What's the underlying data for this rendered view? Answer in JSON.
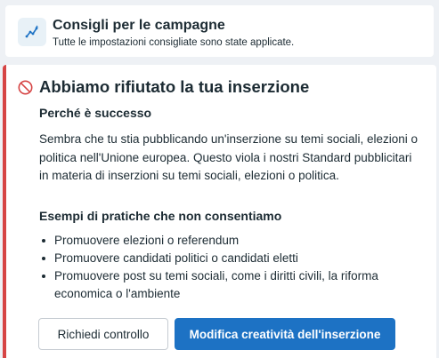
{
  "recommendations": {
    "title": "Consigli per le campagne",
    "subtitle": "Tutte le impostazioni consigliate sono state applicate.",
    "icon": "sparkle-line-chart-icon"
  },
  "rejection": {
    "icon": "prohibited-icon",
    "title": "Abbiamo rifiutato la tua inserzione",
    "why_heading": "Perché è successo",
    "why_body": "Sembra che tu stia pubblicando un'inserzione su temi sociali, elezioni o politica nell'Unione europea. Questo viola i nostri Standard pubblicitari in materia di inserzioni su temi sociali, elezioni o politica.",
    "examples_heading": "Esempi di pratiche che non consentiamo",
    "examples": [
      "Promuovere elezioni o referendum",
      "Promuovere candidati politici o candidati eletti",
      "Promuovere post su temi sociali, come i diritti civili, la riforma economica o l'ambiente"
    ],
    "buttons": {
      "review": "Richiedi controllo",
      "edit": "Modifica creatività dell'inserzione"
    }
  },
  "colors": {
    "accent": "#1d72c4",
    "error": "#d64545",
    "text": "#1c2b33",
    "background": "#eef1f5"
  }
}
